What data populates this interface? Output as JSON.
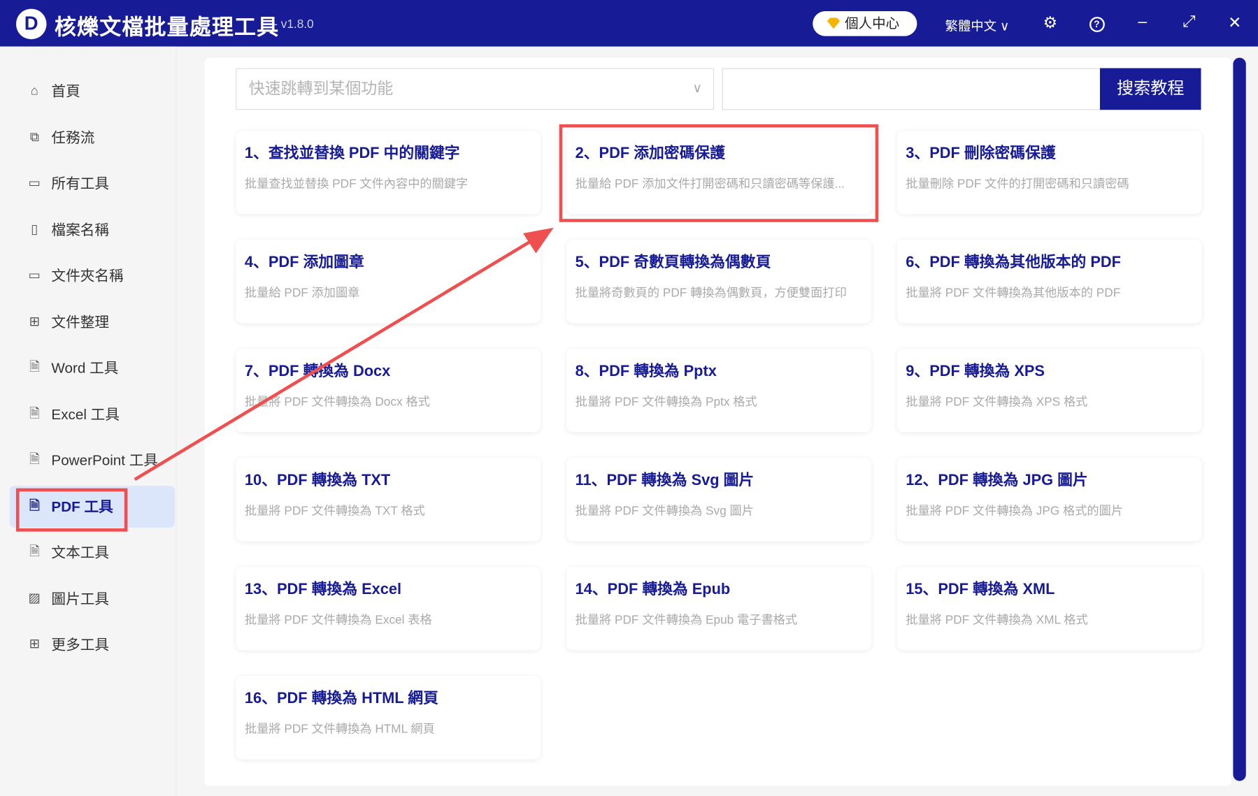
{
  "app": {
    "logo": "D",
    "title": "核爍文檔批量處理工具",
    "version": "- v1.8.0",
    "user_center": "個人中心",
    "language": "繁體中文 ∨"
  },
  "sidebar": {
    "items": [
      {
        "label": "首頁",
        "icon": "home-icon",
        "glyph": "⌂"
      },
      {
        "label": "任務流",
        "icon": "workflow-icon",
        "glyph": "⧉"
      },
      {
        "label": "所有工具",
        "icon": "monitor-icon",
        "glyph": "▭"
      },
      {
        "label": "檔案名稱",
        "icon": "file-name-icon",
        "glyph": "▯"
      },
      {
        "label": "文件夾名稱",
        "icon": "folder-icon",
        "glyph": "▭"
      },
      {
        "label": "文件整理",
        "icon": "organize-icon",
        "glyph": "⊞"
      },
      {
        "label": "Word 工具",
        "icon": "word-file-icon",
        "glyph": "🗎"
      },
      {
        "label": "Excel 工具",
        "icon": "excel-file-icon",
        "glyph": "🗎"
      },
      {
        "label": "PowerPoint 工具",
        "icon": "ppt-file-icon",
        "glyph": "🗎"
      },
      {
        "label": "PDF 工具",
        "icon": "pdf-file-icon",
        "glyph": "🗎"
      },
      {
        "label": "文本工具",
        "icon": "text-file-icon",
        "glyph": "🗎"
      },
      {
        "label": "圖片工具",
        "icon": "image-icon",
        "glyph": "▨"
      },
      {
        "label": "更多工具",
        "icon": "grid-icon",
        "glyph": "⊞"
      }
    ],
    "active_index": 9
  },
  "toolbar": {
    "jump_placeholder": "快速跳轉到某個功能",
    "search_value": "",
    "search_label": "搜索教程"
  },
  "cards": [
    {
      "title": "1、查找並替換 PDF 中的關鍵字",
      "desc": "批量查找並替換 PDF 文件內容中的關鍵字"
    },
    {
      "title": "2、PDF 添加密碼保護",
      "desc": "批量給 PDF 添加文件打開密碼和只讀密碼等保護..."
    },
    {
      "title": "3、PDF 刪除密碼保護",
      "desc": "批量刪除 PDF 文件的打開密碼和只讀密碼"
    },
    {
      "title": "4、PDF 添加圖章",
      "desc": "批量給 PDF 添加圖章"
    },
    {
      "title": "5、PDF 奇數頁轉換為偶數頁",
      "desc": "批量將奇數頁的 PDF 轉換為偶數頁，方便雙面打印"
    },
    {
      "title": "6、PDF 轉換為其他版本的 PDF",
      "desc": "批量將 PDF 文件轉換為其他版本的 PDF"
    },
    {
      "title": "7、PDF 轉換為 Docx",
      "desc": "批量將 PDF 文件轉換為 Docx 格式"
    },
    {
      "title": "8、PDF 轉換為 Pptx",
      "desc": "批量將 PDF 文件轉換為 Pptx 格式"
    },
    {
      "title": "9、PDF 轉換為 XPS",
      "desc": "批量將 PDF 文件轉換為 XPS 格式"
    },
    {
      "title": "10、PDF 轉換為 TXT",
      "desc": "批量將 PDF 文件轉換為 TXT 格式"
    },
    {
      "title": "11、PDF 轉換為 Svg 圖片",
      "desc": "批量將 PDF 文件轉換為 Svg 圖片"
    },
    {
      "title": "12、PDF 轉換為 JPG 圖片",
      "desc": "批量將 PDF 文件轉換為 JPG 格式的圖片"
    },
    {
      "title": "13、PDF 轉換為 Excel",
      "desc": "批量將 PDF 文件轉換為 Excel 表格"
    },
    {
      "title": "14、PDF 轉換為 Epub",
      "desc": "批量將 PDF 文件轉換為 Epub 電子書格式"
    },
    {
      "title": "15、PDF 轉換為 XML",
      "desc": "批量將 PDF 文件轉換為 XML 格式"
    },
    {
      "title": "16、PDF 轉換為 HTML 網頁",
      "desc": "批量將 PDF 文件轉換為 HTML 網頁"
    }
  ],
  "colors": {
    "brand": "#171c96",
    "highlight": "#f04f50",
    "active_bg": "#dbe6fb"
  }
}
